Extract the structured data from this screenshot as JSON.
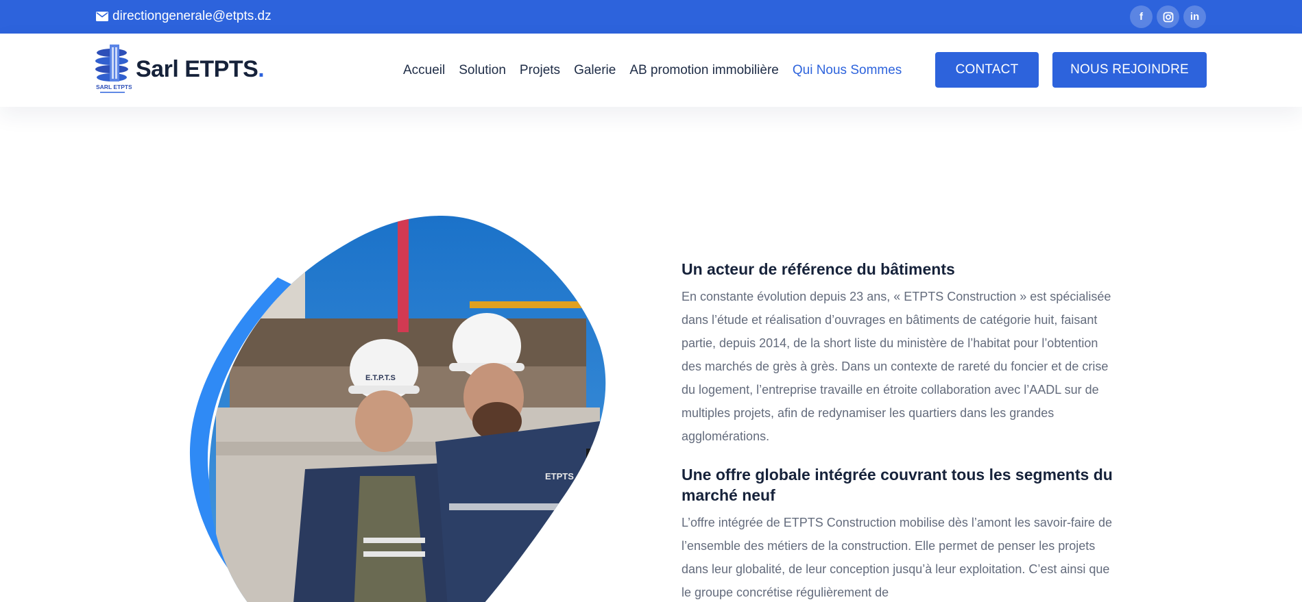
{
  "topbar": {
    "email": "directiongenerale@etpts.dz",
    "email_icon": "mail-icon",
    "socials": [
      {
        "name": "facebook",
        "glyph": "f"
      },
      {
        "name": "instagram",
        "glyph": "◎"
      },
      {
        "name": "linkedin",
        "glyph": "in"
      }
    ]
  },
  "brand": {
    "name": "Sarl ETPTS",
    "dot": ".",
    "logo_caption": "SARL ETPTS"
  },
  "nav": {
    "items": [
      {
        "label": "Accueil"
      },
      {
        "label": "Solution"
      },
      {
        "label": "Projets"
      },
      {
        "label": "Galerie"
      },
      {
        "label": "AB promotion immobilière"
      },
      {
        "label": "Qui Nous Sommes",
        "active": true
      }
    ],
    "contact_label": "CONTACT",
    "join_label": "NOUS REJOINDRE"
  },
  "hero": {
    "helmet_text_1": "E.T.P.T.S",
    "helmet_text_2": "ETPTS"
  },
  "content": {
    "heading1": "Un acteur de référence du bâtiments",
    "paragraph1": "En constante évolution depuis 23 ans, « ETPTS Construction » est spécialisée dans l’étude et réalisation d’ouvrages en bâtiments de catégorie huit, faisant partie, depuis 2014, de la short liste du ministère de l’habitat pour l’obtention des marchés de grès à grès. Dans un contexte de rareté du foncier et de crise du logement, l’entreprise travaille en étroite collaboration avec l’AADL sur de multiples projets, afin de redynamiser les quartiers dans les grandes agglomérations.",
    "heading2": "Une offre globale intégrée couvrant tous les segments du marché neuf",
    "paragraph2": "L’offre intégrée de ETPTS Construction mobilise dès l’amont les savoir-faire de l’ensemble des métiers de la construction. Elle permet de penser les projets dans leur globalité, de leur conception jusqu’à leur exploitation. C’est ainsi que le groupe concrétise régulièrement de"
  },
  "colors": {
    "primary": "#2d63dc",
    "heading": "#16223a",
    "body_text": "#636b7c"
  }
}
